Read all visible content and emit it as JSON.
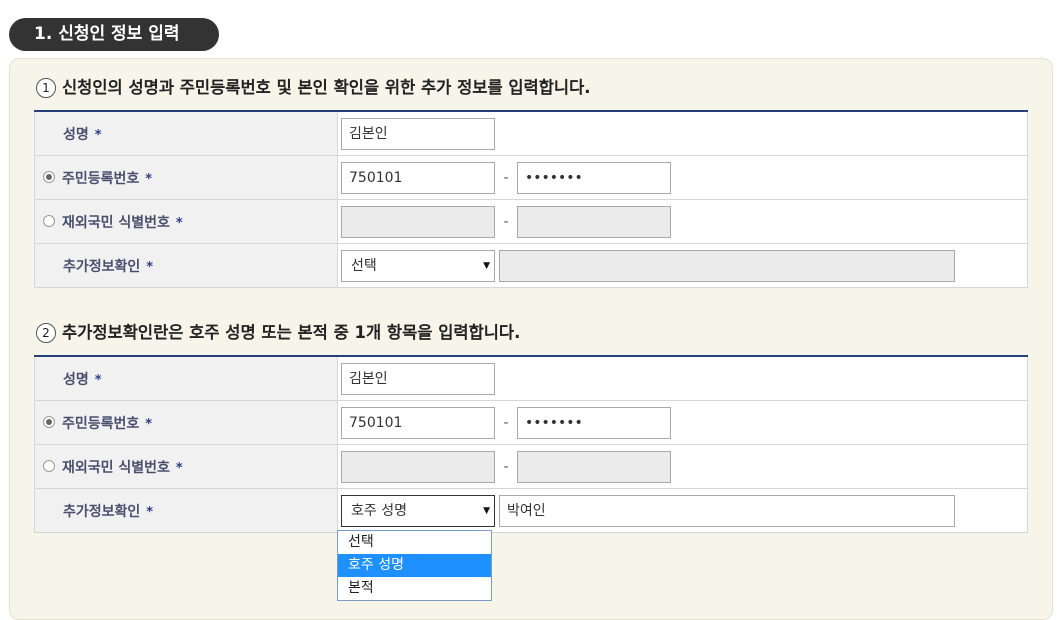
{
  "section": {
    "title": "1. 신청인 정보 입력"
  },
  "step1": {
    "num": "1",
    "title": "신청인의 성명과 주민등록번호 및 본인 확인을 위한 추가 정보를 입력합니다.",
    "rows": {
      "name_label": "성명",
      "name_value": "김본인",
      "rrn_label": "주민등록번호",
      "rrn_front": "750101",
      "rrn_back": "•••••••",
      "foreign_label": "재외국민 식별번호",
      "extra_label": "추가정보확인",
      "extra_select": "선택",
      "extra_value": ""
    }
  },
  "step2": {
    "num": "2",
    "title": "추가정보확인란은 호주 성명 또는 본적 중 1개 항목을 입력합니다.",
    "rows": {
      "name_label": "성명",
      "name_value": "김본인",
      "rrn_label": "주민등록번호",
      "rrn_front": "750101",
      "rrn_back": "•••••••",
      "foreign_label": "재외국민 식별번호",
      "extra_label": "추가정보확인",
      "extra_select": "호주 성명",
      "extra_value": "박여인"
    }
  },
  "common": {
    "star": "*",
    "dash": "-",
    "arrow": "▼"
  },
  "dropdown": {
    "options": [
      "선택",
      "호주 성명",
      "본적"
    ],
    "selected_index": 1
  },
  "colors": {
    "pill": "#333333",
    "panel": "#f7f4ea",
    "table_top": "#27407b",
    "selected_option": "#1e90ff"
  }
}
